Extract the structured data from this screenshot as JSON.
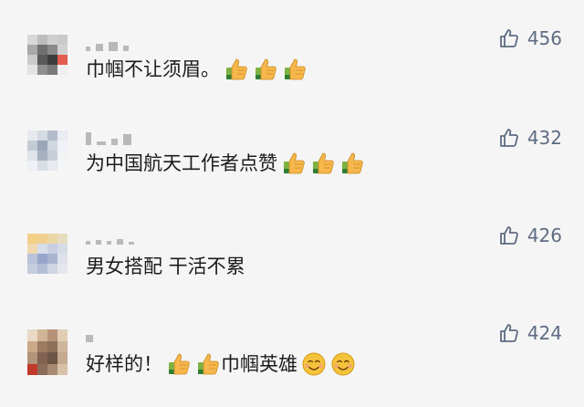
{
  "comments": [
    {
      "text": "巾帼不让须眉。",
      "likes": "456",
      "emoji_icons": [
        "thumbs-up-icon",
        "thumbs-up-icon",
        "thumbs-up-icon"
      ],
      "avatar_colors": [
        "#d8d8d8",
        "#bdbdbd",
        "#cfcfcf",
        "#c9c9c9",
        "#a9a9a9",
        "#6f6f6f",
        "#8a8a8a",
        "#d1d1d1",
        "#cacaca",
        "#5a5a5a",
        "#3c3c3c",
        "#e35a4e",
        "#e3e3e3",
        "#8f8f8f",
        "#7a7a7a",
        "#efefef"
      ]
    },
    {
      "text": "为中国航天工作者点赞",
      "likes": "432",
      "emoji_icons": [
        "thumbs-up-icon",
        "thumbs-up-icon",
        "thumbs-up-icon"
      ],
      "avatar_colors": [
        "#e6eaef",
        "#d5dbe4",
        "#b3bccb",
        "#e9ecf1",
        "#c3cbd6",
        "#9aa6b8",
        "#d1d7e0",
        "#eef1f5",
        "#dfe3ea",
        "#a7b1c1",
        "#c8ced8",
        "#f1f3f6",
        "#edf0f4",
        "#d9dde4",
        "#e7eaef",
        "#f3f5f7"
      ]
    },
    {
      "text": "男女搭配 干活不累",
      "likes": "426",
      "emoji_icons": [],
      "avatar_colors": [
        "#f3cf86",
        "#f1d08f",
        "#ecd6a6",
        "#e8dcc0",
        "#f0d9b0",
        "#d9dde8",
        "#c8cfe1",
        "#d7dbe6",
        "#b9c3d9",
        "#96a5c9",
        "#a8b4d0",
        "#dfe2ea",
        "#c5ccdc",
        "#b3bdd6",
        "#d0d5e2",
        "#e5e7ee"
      ]
    },
    {
      "text": "好样的！",
      "text_after": "巾帼英雄",
      "likes": "424",
      "emoji_icons": [
        "thumbs-up-icon",
        "thumbs-up-icon"
      ],
      "emoji_icons_after": [
        "smiling-face-icon",
        "smiling-face-icon"
      ],
      "avatar_colors": [
        "#e9d9c4",
        "#d1b596",
        "#b69378",
        "#e1cdb6",
        "#caa98a",
        "#9b7b62",
        "#8e6f59",
        "#cdb49a",
        "#b09479",
        "#7f624f",
        "#6d5444",
        "#c4a98f",
        "#c0392b",
        "#8a6c58",
        "#a78a73",
        "#d7c1a9"
      ]
    }
  ],
  "colors": {
    "like": "#5e6c83",
    "text": "#1c1c1c",
    "background": "#f5f5f5",
    "thumb": "#f7b74c",
    "smile": "#f5c33b"
  }
}
